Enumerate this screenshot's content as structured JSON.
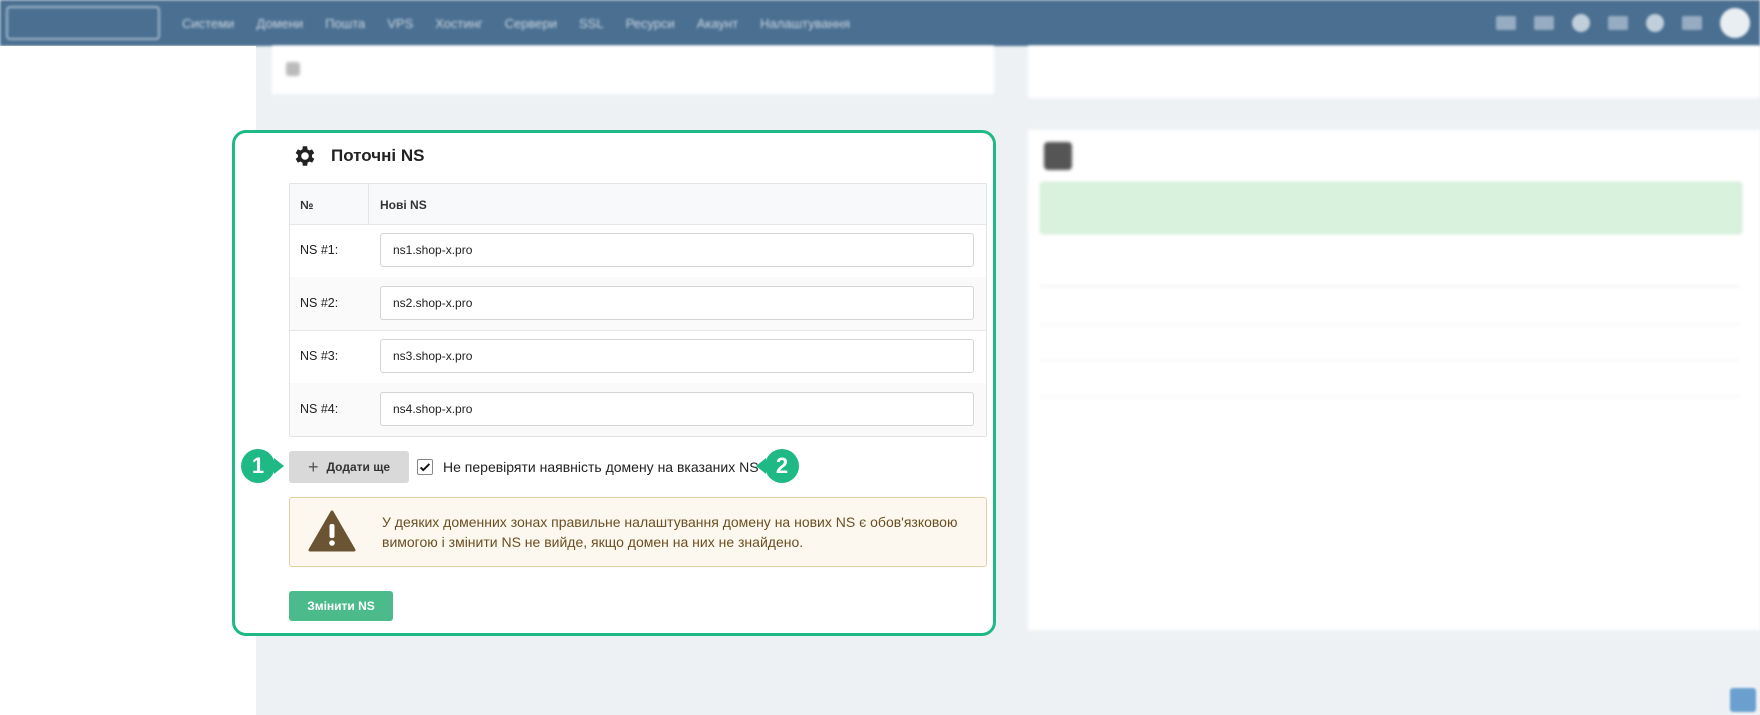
{
  "topbar": {
    "items": [
      "Logo",
      "Системи",
      "Домени",
      "Пошта",
      "VPS",
      "Хостинг",
      "Сервери",
      "SSL",
      "Ресурси",
      "Акаунт",
      "Налаштування"
    ]
  },
  "main_card": {
    "title": "Поточні NS",
    "table": {
      "col_num": "№",
      "col_ns": "Нові NS",
      "rows": [
        {
          "label": "NS #1:",
          "value": "ns1.shop-x.pro"
        },
        {
          "label": "NS #2:",
          "value": "ns2.shop-x.pro"
        },
        {
          "label": "NS #3:",
          "value": "ns3.shop-x.pro"
        },
        {
          "label": "NS #4:",
          "value": "ns4.shop-x.pro"
        }
      ]
    },
    "add_button": "Додати ще",
    "checkbox_label": "Не перевіряти наявність домену на вказаних NS",
    "checkbox_checked": true,
    "warning_text": "У деяких доменних зонах правильне налаштування домену на нових NS є обов'язковою вимогою і змінити NS не вийде, якщо домен на них не знайдено.",
    "submit_button": "Змінити NS"
  },
  "badges": {
    "first": "1",
    "second": "2"
  },
  "colors": {
    "accent": "#1fb985",
    "topbar": "#4a6f91",
    "submit": "#4bbb8c",
    "warning_bg": "#fdf8ef"
  }
}
